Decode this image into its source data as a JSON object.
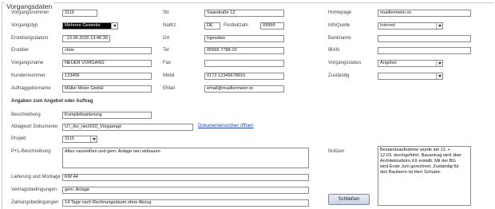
{
  "section_title": "Vorgangsdaten",
  "col1": {
    "vorgangsnummer": {
      "label": "Vorgangsnummer",
      "value": "3115"
    },
    "vorgangstyp": {
      "label": "Vorgangstyp",
      "value": "Mehrere Gewerke"
    },
    "erstellungsdatum": {
      "label": "Erstellungsdatum",
      "value": "13.06.2020 13:46:39"
    },
    "ersteller": {
      "label": "Ersteller",
      "value": "chris"
    },
    "vorgangsname": {
      "label": "Vorgangsname",
      "value": "NEUER VORGANG"
    },
    "kundennummer": {
      "label": "Kundennummer",
      "value": "123456"
    },
    "auftraggebername": {
      "label": "Auftraggebername",
      "value": "Müller Meier GmbH"
    }
  },
  "col2": {
    "str": {
      "label": "Str",
      "value": "Saarstraße 12"
    },
    "natkz": {
      "label": "NatKz",
      "value": "DE"
    },
    "postleitzahl": {
      "label": "Postleitzahl",
      "value": "09999"
    },
    "ort": {
      "label": "Ort",
      "value": "Irgendwo"
    },
    "tel": {
      "label": "Tel",
      "value": "05566 7788-10"
    },
    "fax": {
      "label": "Fax",
      "value": ""
    },
    "mobil": {
      "label": "Mobil",
      "value": "0172 12345678910"
    },
    "email": {
      "label": "EMail",
      "value": "email@muellermeier.xx"
    }
  },
  "col3": {
    "homepage": {
      "label": "Homepage",
      "value": "muellermeier.xx"
    },
    "infoquelle": {
      "label": "InfoQuelle",
      "value": "Internet"
    },
    "bankname": {
      "label": "Bankname",
      "value": ""
    },
    "iban": {
      "label": "IBAN",
      "value": ""
    },
    "vorgangsstatus": {
      "label": "Vorgangsstatus",
      "value": "Angebot"
    },
    "zustaendig": {
      "label": "Zuständig",
      "value": ""
    }
  },
  "angaben": {
    "heading": "Angaben zum Angebot oder Auftrag",
    "beschreibung": {
      "label": "Beschreibung",
      "value": "Komplettsanierung"
    },
    "ablageort": {
      "label": "Ablageort Dokumente",
      "value": "U:\\_rkv_neu\\010_Vorgaenge"
    },
    "dokumente_link": "Dokumentenordner öffnen",
    "projekt": {
      "label": "Projekt",
      "value": "3115"
    },
    "pl_beschreibung": {
      "label": "P+L-Beschreibung",
      "value": "Altes rausreißen und gem. Anlage neu einbauen"
    },
    "lieferung": {
      "label": "Lieferung und Montage",
      "value": "KW 44"
    },
    "vertragsbedingungen": {
      "label": "Vertragsbedingungen",
      "value": "gem. Anlage"
    },
    "zahlungsbedingungen": {
      "label": "Zahlungsbedingungen",
      "value": "14 Tage nach Rechnungsdaum ohne Abzug"
    }
  },
  "notizen": {
    "label": "Notizen",
    "value": "Bestandsaufnahme wurde am 11. + 12.03. durchgeführt. Bauantrag wird über Architekturbüro XX erstellt. Mit der BG wird Ende Juni gerechnet. Zuständig für den Bauherrn ist Herr Schulze."
  },
  "close_button": "Schließen"
}
